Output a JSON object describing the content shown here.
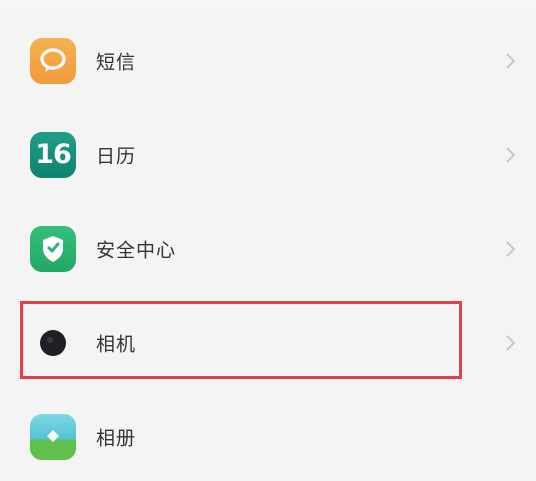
{
  "settings_list": {
    "items": [
      {
        "label": "短信",
        "icon": "message-bubble-icon",
        "color": "#f2a442"
      },
      {
        "label": "日历",
        "icon": "calendar-icon",
        "icon_text": "16",
        "color": "#15907b"
      },
      {
        "label": "安全中心",
        "icon": "shield-icon",
        "color": "#29b46f"
      },
      {
        "label": "相机",
        "icon": "camera-lens-icon",
        "color": "#1f1f25",
        "highlighted": true
      },
      {
        "label": "相册",
        "icon": "gallery-landscape-icon",
        "color": "#5fc04d"
      }
    ]
  },
  "highlight": {
    "color": "#e3404a"
  }
}
